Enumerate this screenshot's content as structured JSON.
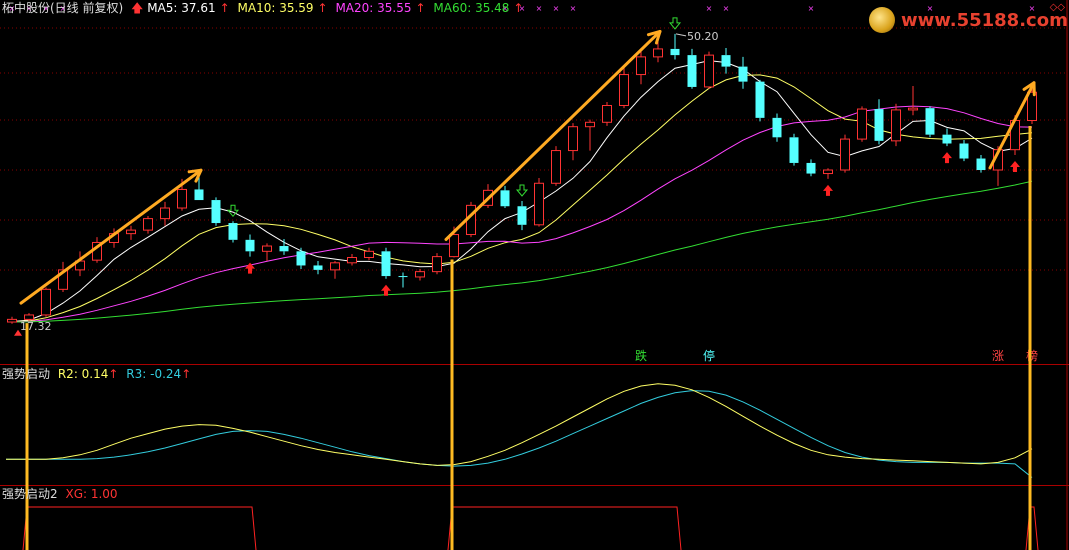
{
  "header": {
    "stock_title": "柘中股份(日线 前复权)",
    "ma5": "MA5: 37.61",
    "ma10": "MA10: 35.59",
    "ma20": "MA20: 35.55",
    "ma60": "MA60: 35.48",
    "indicator1_name": "强势启动",
    "r2": "R2: 0.14",
    "r3": "R3: -0.24",
    "indicator2_name": "强势启动2",
    "xg": "XG: 1.00"
  },
  "watermark": "www.55188.com",
  "colors": {
    "ma5": "#ffffff",
    "ma10": "#ffff66",
    "ma20": "#ff44ff",
    "ma60": "#33dd33",
    "up_candle": "#ff3333",
    "down_candle": "#55ffff",
    "arrow": "#ffaa22",
    "r2": "#ffff66",
    "r3": "#33ccdd",
    "divider": "#aa0000",
    "grid": "#880000"
  },
  "chart_data": {
    "type": "candlestick",
    "high_label": "50.20",
    "low_label": "17.32",
    "price_markers": [
      {
        "label": "跌",
        "index": 37
      },
      {
        "label": "停",
        "index": 41
      },
      {
        "label": "涨",
        "index": 58
      },
      {
        "label": "榜",
        "index": 60
      }
    ],
    "candles": [
      [
        17.6,
        18.2,
        17.4,
        17.9
      ],
      [
        17.9,
        18.6,
        17.7,
        18.4
      ],
      [
        18.4,
        21.5,
        18.2,
        21.3
      ],
      [
        21.3,
        24.4,
        21.0,
        23.5
      ],
      [
        23.5,
        25.6,
        22.8,
        24.5
      ],
      [
        24.6,
        27.2,
        24.3,
        26.6
      ],
      [
        26.6,
        28.2,
        26.0,
        27.6
      ],
      [
        27.6,
        28.5,
        26.9,
        28.0
      ],
      [
        28.0,
        29.6,
        27.6,
        29.3
      ],
      [
        29.3,
        31.2,
        28.5,
        30.5
      ],
      [
        30.5,
        33.8,
        30.2,
        32.6
      ],
      [
        32.6,
        34.1,
        31.5,
        31.4
      ],
      [
        31.4,
        31.7,
        28.5,
        28.8
      ],
      [
        28.8,
        29.0,
        26.6,
        26.9
      ],
      [
        26.9,
        27.5,
        25.0,
        25.6
      ],
      [
        25.6,
        26.5,
        24.5,
        26.2
      ],
      [
        26.2,
        27.0,
        25.2,
        25.6
      ],
      [
        25.6,
        26.0,
        23.6,
        24.0
      ],
      [
        24.0,
        24.5,
        23.0,
        23.5
      ],
      [
        23.5,
        24.5,
        22.5,
        24.3
      ],
      [
        24.3,
        25.3,
        24.0,
        24.9
      ],
      [
        24.9,
        26.0,
        24.6,
        25.6
      ],
      [
        25.6,
        26.0,
        22.5,
        22.8
      ],
      [
        22.8,
        23.2,
        21.5,
        22.7
      ],
      [
        22.7,
        23.6,
        22.3,
        23.3
      ],
      [
        23.3,
        25.4,
        23.0,
        25.0
      ],
      [
        25.0,
        28.4,
        24.9,
        27.5
      ],
      [
        27.5,
        31.2,
        27.2,
        30.8
      ],
      [
        30.8,
        33.2,
        30.5,
        32.5
      ],
      [
        32.5,
        33.0,
        30.5,
        30.7
      ],
      [
        30.7,
        31.3,
        28.0,
        28.6
      ],
      [
        28.6,
        33.9,
        28.4,
        33.3
      ],
      [
        33.3,
        37.5,
        33.0,
        37.0
      ],
      [
        37.0,
        40.1,
        35.9,
        39.7
      ],
      [
        39.7,
        40.5,
        37.0,
        40.2
      ],
      [
        40.2,
        42.5,
        39.8,
        42.1
      ],
      [
        42.1,
        46.5,
        41.8,
        45.6
      ],
      [
        45.6,
        48.3,
        44.5,
        47.6
      ],
      [
        47.6,
        49.8,
        47.0,
        48.5
      ],
      [
        48.5,
        50.2,
        47.3,
        47.8
      ],
      [
        47.8,
        48.5,
        44.0,
        44.2
      ],
      [
        44.2,
        48.2,
        44.0,
        47.8
      ],
      [
        47.8,
        48.6,
        45.7,
        46.5
      ],
      [
        46.5,
        47.6,
        44.0,
        44.8
      ],
      [
        44.8,
        45.0,
        40.3,
        40.7
      ],
      [
        40.7,
        41.2,
        38.0,
        38.5
      ],
      [
        38.5,
        38.9,
        35.3,
        35.6
      ],
      [
        35.6,
        36.0,
        34.1,
        34.4
      ],
      [
        34.4,
        35.0,
        33.8,
        34.8
      ],
      [
        34.8,
        38.8,
        34.5,
        38.3
      ],
      [
        38.3,
        42.0,
        38.0,
        41.7
      ],
      [
        41.7,
        42.8,
        37.7,
        38.1
      ],
      [
        38.1,
        42.3,
        37.5,
        41.6
      ],
      [
        41.6,
        44.3,
        41.0,
        41.8
      ],
      [
        41.8,
        42.0,
        38.5,
        38.8
      ],
      [
        38.8,
        39.5,
        37.5,
        37.8
      ],
      [
        37.8,
        38.2,
        35.8,
        36.1
      ],
      [
        36.1,
        36.5,
        34.5,
        34.8
      ],
      [
        34.8,
        37.5,
        33.0,
        37.1
      ],
      [
        37.1,
        41.0,
        36.5,
        40.4
      ],
      [
        40.4,
        44.0,
        40.0,
        43.6
      ]
    ],
    "ma_series": [
      {
        "name": "MA5"
      },
      {
        "name": "MA10"
      },
      {
        "name": "MA20"
      },
      {
        "name": "MA60"
      }
    ],
    "oscillator": {
      "r2": [
        0.0,
        0.0,
        0.0,
        0.02,
        0.06,
        0.12,
        0.2,
        0.28,
        0.34,
        0.4,
        0.44,
        0.46,
        0.45,
        0.41,
        0.36,
        0.3,
        0.24,
        0.18,
        0.13,
        0.09,
        0.06,
        0.03,
        0.0,
        -0.03,
        -0.06,
        -0.08,
        -0.07,
        -0.03,
        0.04,
        0.12,
        0.22,
        0.33,
        0.44,
        0.56,
        0.68,
        0.8,
        0.9,
        0.97,
        1.0,
        0.98,
        0.92,
        0.82,
        0.7,
        0.57,
        0.44,
        0.32,
        0.21,
        0.12,
        0.06,
        0.03,
        0.01,
        0.0,
        -0.01,
        -0.02,
        -0.03,
        -0.04,
        -0.05,
        -0.06,
        -0.04,
        0.02,
        0.14
      ],
      "r3": [
        0.0,
        0.0,
        0.0,
        0.0,
        0.0,
        0.01,
        0.03,
        0.06,
        0.1,
        0.15,
        0.21,
        0.27,
        0.33,
        0.37,
        0.38,
        0.37,
        0.33,
        0.28,
        0.22,
        0.16,
        0.1,
        0.05,
        0.01,
        -0.03,
        -0.06,
        -0.08,
        -0.09,
        -0.08,
        -0.05,
        0.0,
        0.07,
        0.15,
        0.24,
        0.34,
        0.44,
        0.54,
        0.64,
        0.74,
        0.82,
        0.88,
        0.91,
        0.9,
        0.85,
        0.76,
        0.65,
        0.53,
        0.41,
        0.29,
        0.18,
        0.09,
        0.03,
        -0.01,
        -0.03,
        -0.04,
        -0.04,
        -0.04,
        -0.05,
        -0.05,
        -0.05,
        -0.06,
        -0.24
      ]
    },
    "xg_blocks": [
      {
        "start": 1,
        "end": 14
      },
      {
        "start": 26,
        "end": 39
      },
      {
        "start": 60,
        "end": 60
      }
    ],
    "signal_columns": [
      1,
      26,
      60
    ],
    "buy_arrows": [
      14,
      22,
      48,
      55,
      59
    ],
    "sell_arrows": [
      13,
      39,
      30
    ],
    "trend_arrows": [
      {
        "from": 1,
        "to": 11
      },
      {
        "from": 26,
        "to": 38
      },
      {
        "from": 58,
        "to": 60
      }
    ]
  }
}
